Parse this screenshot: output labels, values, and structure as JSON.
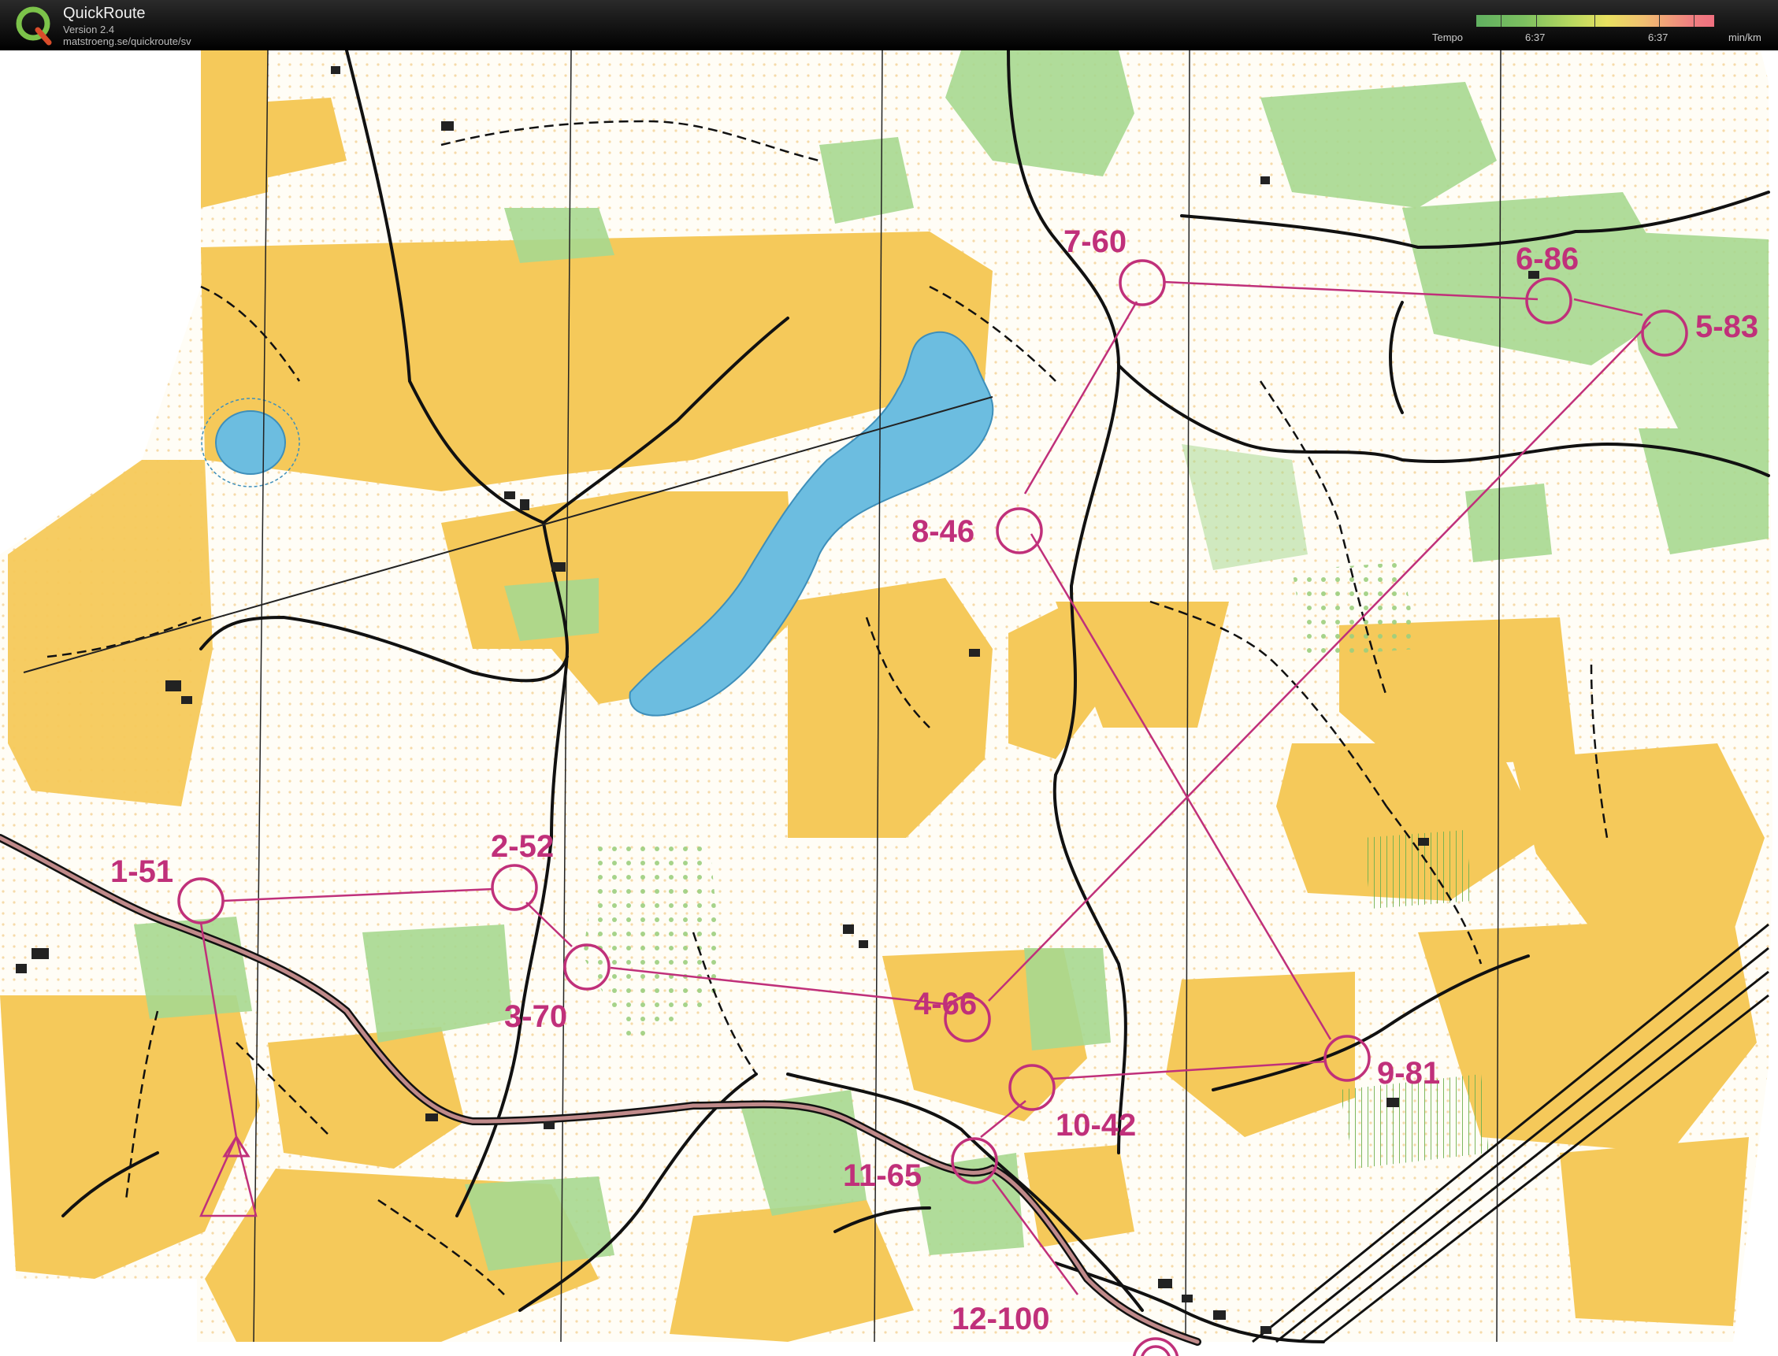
{
  "header": {
    "app_title": "QuickRoute",
    "version": "Version 2.4",
    "url": "matstroeng.se/quickroute/sv",
    "tempo_label": "Tempo",
    "tempo_min": "6:37",
    "tempo_max": "6:37",
    "tempo_unit": "min/km"
  },
  "colors": {
    "course": "#c0307a",
    "open_land": "#f5c95a",
    "forest": "#ffffff",
    "green": "#a8d890",
    "water": "#6cbde0",
    "road": "#111111"
  },
  "controls": [
    {
      "label": "1-51"
    },
    {
      "label": "2-52"
    },
    {
      "label": "3-70"
    },
    {
      "label": "4-66"
    },
    {
      "label": "5-83"
    },
    {
      "label": "6-86"
    },
    {
      "label": "7-60"
    },
    {
      "label": "8-46"
    },
    {
      "label": "9-81"
    },
    {
      "label": "10-42"
    },
    {
      "label": "11-65"
    },
    {
      "label": "12-100"
    }
  ]
}
